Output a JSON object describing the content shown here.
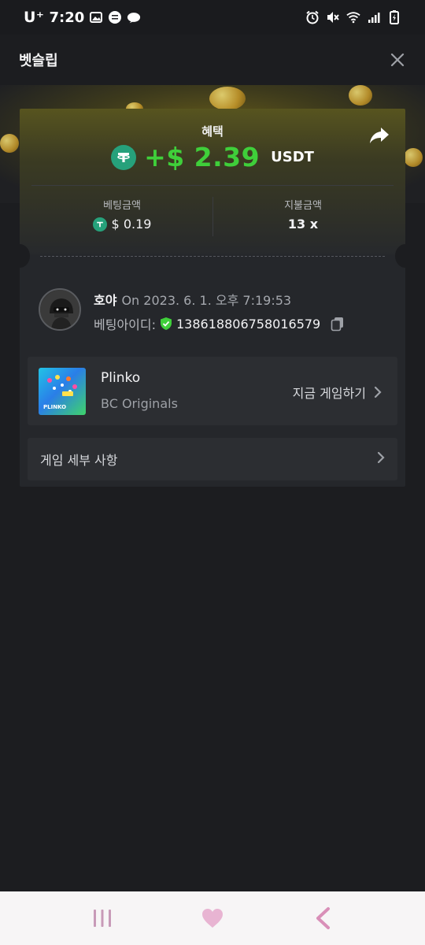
{
  "status_bar": {
    "carrier": "U⁺",
    "time": "7:20"
  },
  "header": {
    "title": "벳슬립"
  },
  "benefit": {
    "label": "혜택",
    "amount": "+$ 2.39",
    "unit": "USDT"
  },
  "stats": {
    "bet_amount_label": "베팅금액",
    "bet_amount_value": "$ 0.19",
    "payout_label": "지불금액",
    "payout_value": "13 x"
  },
  "user": {
    "name": "호야",
    "date": "On 2023. 6. 1. 오후 7:19:53",
    "bet_id_label": "베팅아이디:",
    "bet_id": "138618806758016579"
  },
  "game": {
    "name": "Plinko",
    "provider": "BC Originals",
    "play_now_label": "지금 게임하기",
    "thumb_text": "PLINKO"
  },
  "details": {
    "label": "게임 세부 사항"
  },
  "colors": {
    "accent_green": "#3fcf3a",
    "tether": "#26a17b",
    "background": "#1c1d20",
    "card": "#25272b"
  }
}
